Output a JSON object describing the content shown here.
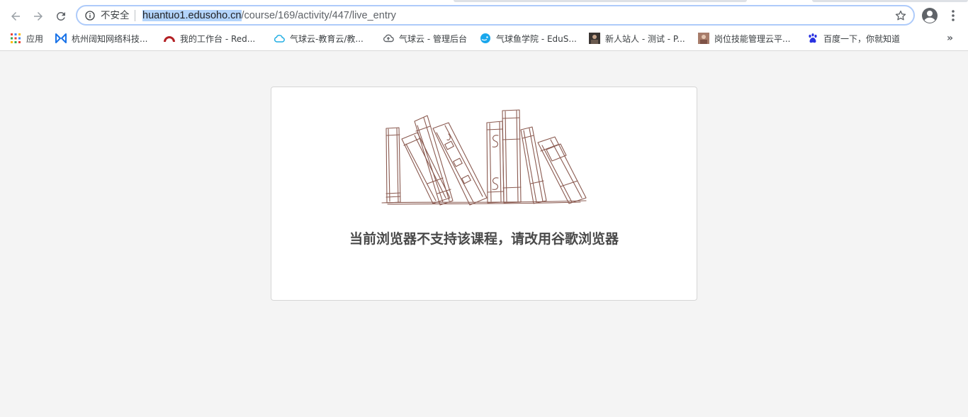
{
  "browser": {
    "security_label": "不安全",
    "url_host": "huantuo1.edusoho.cn",
    "url_path": "/course/169/activity/447/live_entry",
    "icons": {
      "back": "arrow-left-icon",
      "forward": "arrow-right-icon",
      "reload": "reload-icon",
      "info": "info-icon",
      "star": "star-icon",
      "profile": "account-icon",
      "menu": "kebab-menu-icon"
    }
  },
  "bookmarks": {
    "items": [
      {
        "label": "应用",
        "icon": "apps-grid-icon"
      },
      {
        "label": "杭州阔知网络科技...",
        "icon": "bowtie-logo-icon"
      },
      {
        "label": "我的工作台 - Red...",
        "icon": "redmine-arc-icon"
      },
      {
        "label": "气球云-教育云/教...",
        "icon": "cloud-icon"
      },
      {
        "label": "气球云 - 管理后台",
        "icon": "cloud-upload-icon"
      },
      {
        "label": "气球鱼学院 - EduS...",
        "icon": "fish-icon"
      },
      {
        "label": "新人站人 - 测试 - P...",
        "icon": "avatar-thumb-icon"
      },
      {
        "label": "岗位技能管理云平...",
        "icon": "avatar-thumb-icon"
      },
      {
        "label": "百度一下，你就知道",
        "icon": "baidu-paw-icon"
      }
    ],
    "more": "»"
  },
  "page": {
    "message": "当前浏览器不支持该课程，请改用谷歌浏览器",
    "illustration": "bookshelf-sketch-icon",
    "colors": {
      "sketch": "#8a5a50",
      "background": "#f4f4f4",
      "text": "#4a4a4a"
    }
  }
}
